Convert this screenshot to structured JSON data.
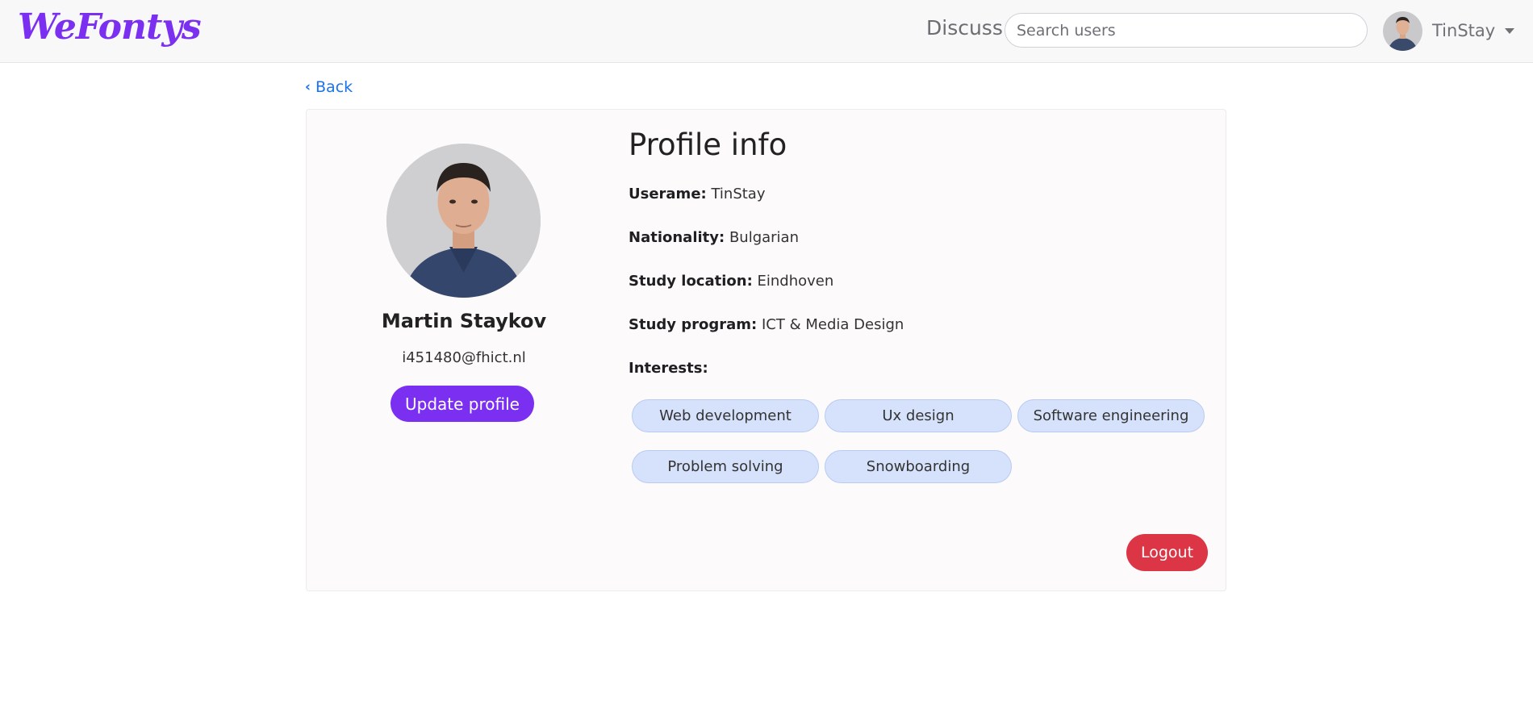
{
  "navbar": {
    "brand": "WeFontys",
    "discuss_label": "Discuss",
    "search_placeholder": "Search users",
    "username": "TinStay"
  },
  "back_label": "Back",
  "profile": {
    "full_name": "Martin Staykov",
    "email": "i451480@fhict.nl",
    "update_button": "Update profile",
    "info_title": "Profile info",
    "fields": [
      {
        "label": "Userame:",
        "value": "TinStay"
      },
      {
        "label": "Nationality:",
        "value": "Bulgarian"
      },
      {
        "label": "Study location:",
        "value": "Eindhoven"
      },
      {
        "label": "Study program:",
        "value": "ICT & Media Design"
      }
    ],
    "interests_label": "Interests:",
    "interests": [
      "Web development",
      "Ux design",
      "Software engineering",
      "Problem solving",
      "Snowboarding"
    ],
    "logout_button": "Logout"
  },
  "colors": {
    "brand": "#7b2ff0",
    "link": "#1a73e8",
    "chip_bg": "#d6e2fb",
    "logout": "#dc3545"
  },
  "icons": {
    "back": "chevron-left-icon",
    "user_menu": "caret-down-icon"
  }
}
